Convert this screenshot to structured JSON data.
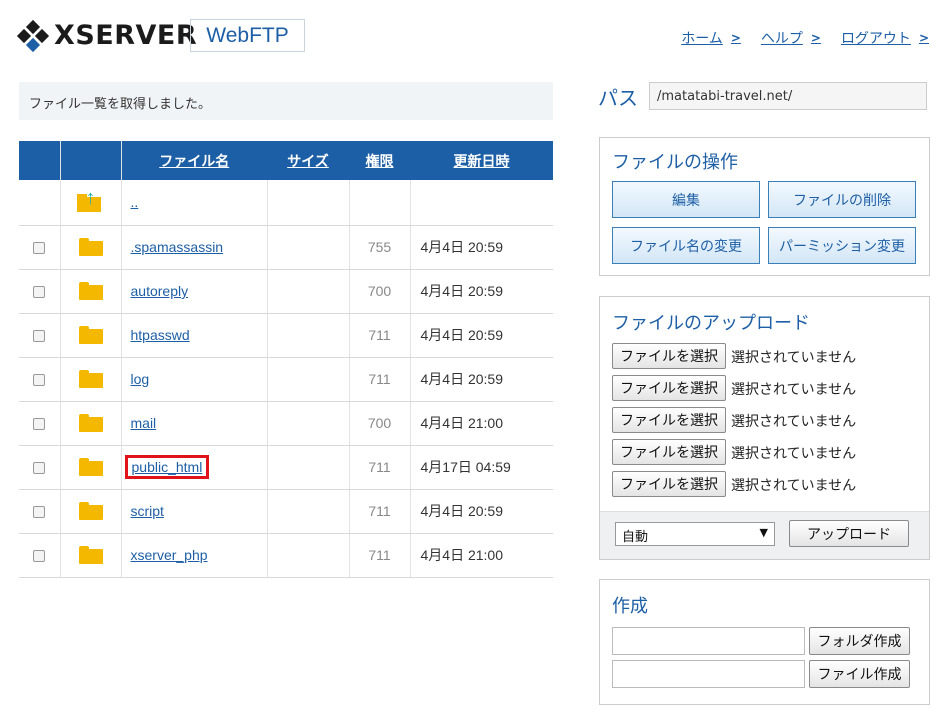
{
  "header": {
    "logo_text": "XSERVER",
    "product": "WebFTP",
    "nav": [
      {
        "label": "ホーム"
      },
      {
        "label": "ヘルプ"
      },
      {
        "label": "ログアウト"
      }
    ]
  },
  "status_message": "ファイル一覧を取得しました。",
  "table": {
    "headers": {
      "name": "ファイル名",
      "size": "サイズ",
      "perm": "権限",
      "date": "更新日時"
    },
    "parent": {
      "name": ".."
    },
    "rows": [
      {
        "name": ".spamassassin",
        "size": "",
        "perm": "755",
        "date": "4月4日 20:59"
      },
      {
        "name": "autoreply",
        "size": "",
        "perm": "700",
        "date": "4月4日 20:59"
      },
      {
        "name": "htpasswd",
        "size": "",
        "perm": "711",
        "date": "4月4日 20:59"
      },
      {
        "name": "log",
        "size": "",
        "perm": "711",
        "date": "4月4日 20:59"
      },
      {
        "name": "mail",
        "size": "",
        "perm": "700",
        "date": "4月4日 21:00"
      },
      {
        "name": "public_html",
        "size": "",
        "perm": "711",
        "date": "4月17日 04:59",
        "highlighted": true
      },
      {
        "name": "script",
        "size": "",
        "perm": "711",
        "date": "4月4日 20:59"
      },
      {
        "name": "xserver_php",
        "size": "",
        "perm": "711",
        "date": "4月4日 21:00"
      }
    ]
  },
  "path": {
    "label": "パス",
    "value": "/matatabi-travel.net/"
  },
  "operations": {
    "title": "ファイルの操作",
    "edit": "編集",
    "delete": "ファイルの削除",
    "rename": "ファイル名の変更",
    "permission": "パーミッション変更"
  },
  "upload": {
    "title": "ファイルのアップロード",
    "choose_label": "ファイルを選択",
    "none_selected": "選択されていません",
    "mode": "自動",
    "button": "アップロード"
  },
  "create": {
    "title": "作成",
    "folder_button": "フォルダ作成",
    "file_button": "ファイル作成"
  },
  "colors": {
    "accent": "#1d5fa6",
    "highlight": "#e0121a",
    "folder": "#f5b800"
  }
}
